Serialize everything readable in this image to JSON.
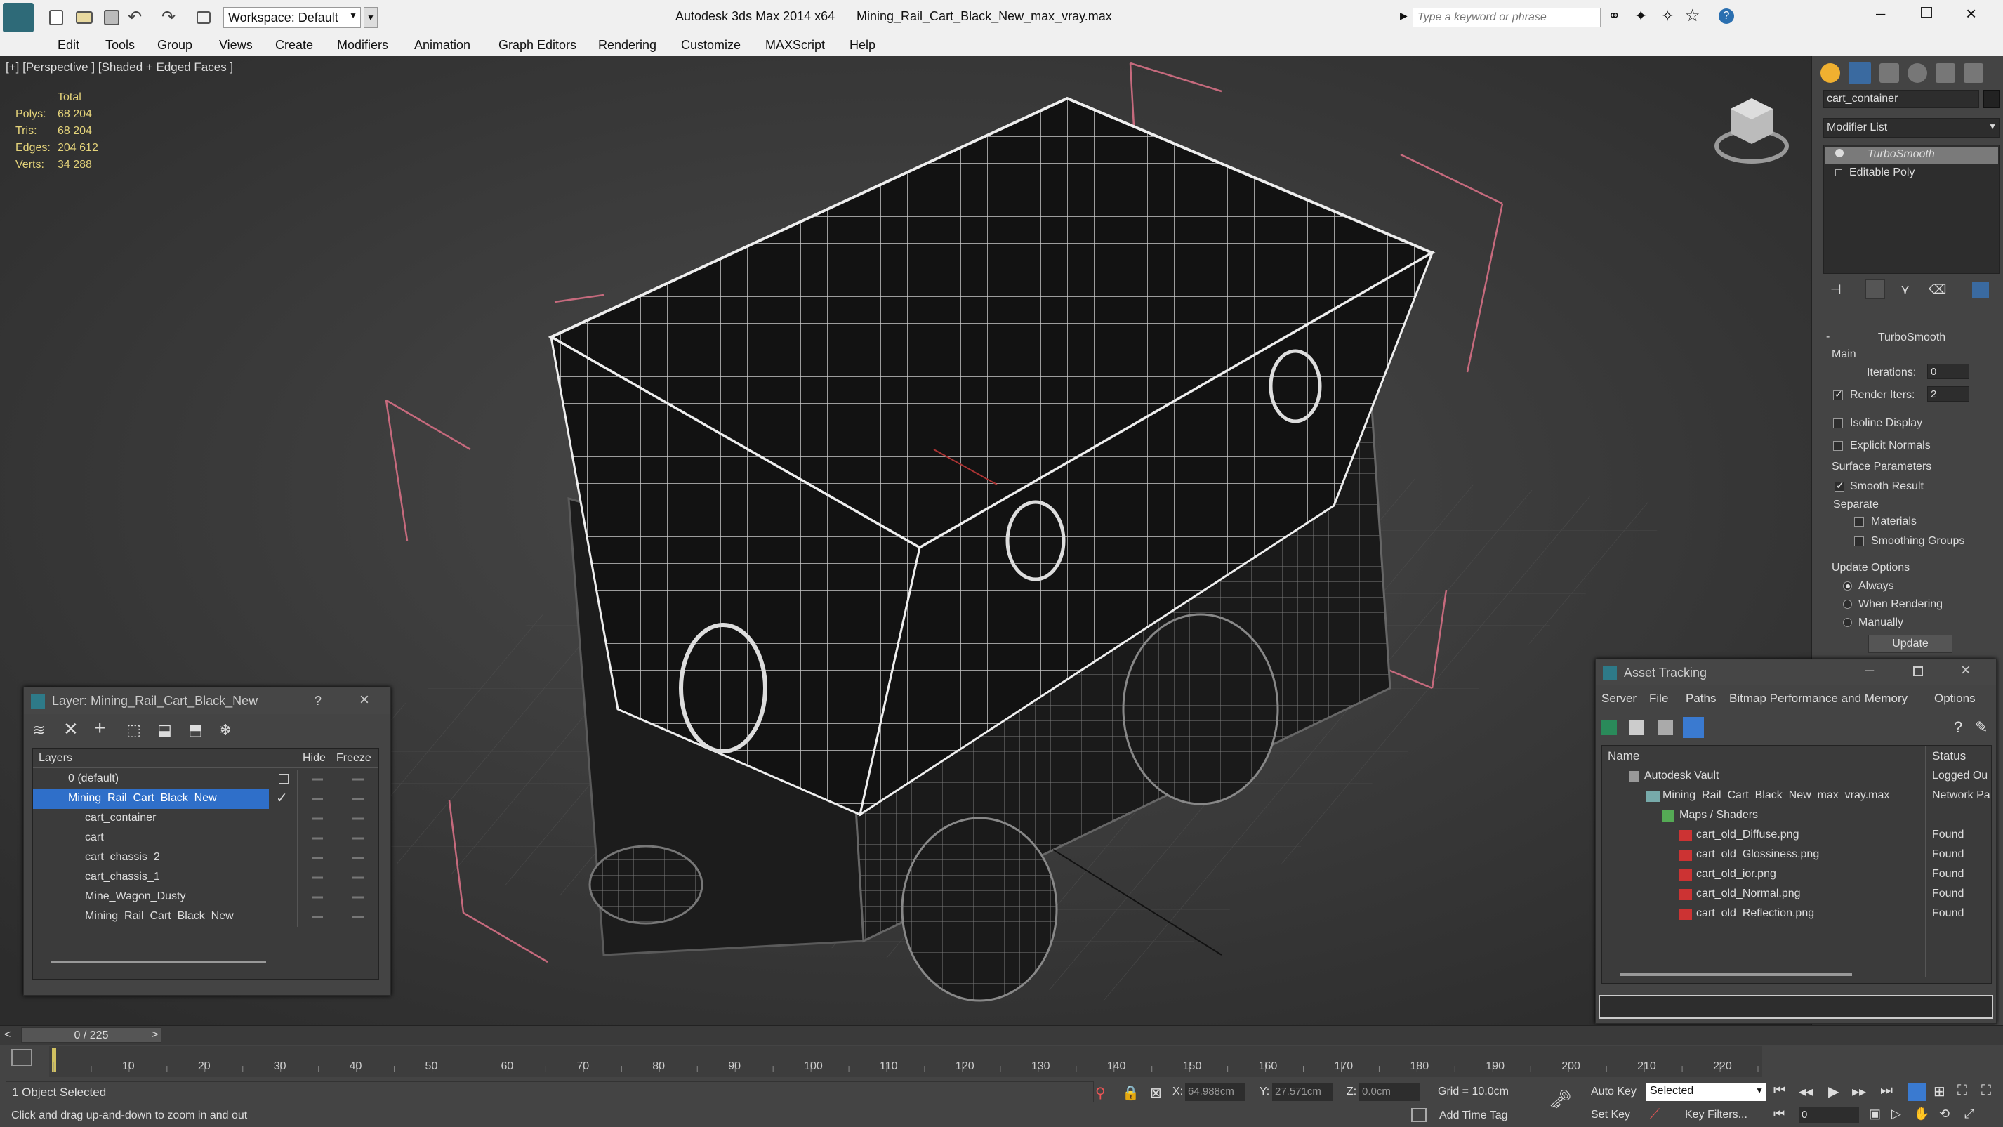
{
  "titlebar": {
    "app": "Autodesk 3ds Max  2014 x64",
    "file": "Mining_Rail_Cart_Black_New_max_vray.max",
    "workspace": "Workspace: Default",
    "search_placeholder": "Type a keyword or phrase"
  },
  "menu": [
    "Edit",
    "Tools",
    "Group",
    "Views",
    "Create",
    "Modifiers",
    "Animation",
    "Graph Editors",
    "Rendering",
    "Customize",
    "MAXScript",
    "Help"
  ],
  "viewport": {
    "label": "[+] [Perspective ] [Shaded + Edged Faces ]",
    "stats_header": "Total",
    "stats": [
      {
        "k": "Polys:",
        "v": "68 204"
      },
      {
        "k": "Tris:",
        "v": "68 204"
      },
      {
        "k": "Edges:",
        "v": "204 612"
      },
      {
        "k": "Verts:",
        "v": "34 288"
      }
    ]
  },
  "cmd": {
    "object_name": "cart_container",
    "modifier_list": "Modifier List",
    "stack": [
      "TurboSmooth",
      "Editable Poly"
    ],
    "rollout": "TurboSmooth",
    "main": "Main",
    "iterations_label": "Iterations:",
    "iterations": "0",
    "render_iters_label": "Render Iters:",
    "render_iters": "2",
    "isoline": "Isoline Display",
    "explicit": "Explicit Normals",
    "surface": "Surface Parameters",
    "smooth": "Smooth Result",
    "separate": "Separate",
    "materials": "Materials",
    "smoothing_groups": "Smoothing Groups",
    "update_options": "Update Options",
    "always": "Always",
    "when_rendering": "When Rendering",
    "manually": "Manually",
    "update_btn": "Update"
  },
  "layer": {
    "title": "Layer: Mining_Rail_Cart_Black_New",
    "help": "?",
    "col_layers": "Layers",
    "col_hide": "Hide",
    "col_freeze": "Freeze",
    "rows": [
      "0 (default)",
      "Mining_Rail_Cart_Black_New",
      "cart_container",
      "cart",
      "cart_chassis_2",
      "cart_chassis_1",
      "Mine_Wagon_Dusty",
      "Mining_Rail_Cart_Black_New"
    ]
  },
  "asset": {
    "title": "Asset Tracking",
    "menu": [
      "Server",
      "File",
      "Paths",
      "Bitmap Performance and Memory",
      "Options"
    ],
    "col_name": "Name",
    "col_status": "Status",
    "rows": [
      {
        "name": "Autodesk Vault",
        "status": "Logged Ou"
      },
      {
        "name": "Mining_Rail_Cart_Black_New_max_vray.max",
        "status": "Network Pa"
      },
      {
        "name": "Maps / Shaders",
        "status": ""
      },
      {
        "name": "cart_old_Diffuse.png",
        "status": "Found"
      },
      {
        "name": "cart_old_Glossiness.png",
        "status": "Found"
      },
      {
        "name": "cart_old_ior.png",
        "status": "Found"
      },
      {
        "name": "cart_old_Normal.png",
        "status": "Found"
      },
      {
        "name": "cart_old_Reflection.png",
        "status": "Found"
      }
    ]
  },
  "timeline": {
    "frame": "0 / 225",
    "ticks": [
      "10",
      "20",
      "30",
      "40",
      "50",
      "60",
      "70",
      "80",
      "90",
      "100",
      "110",
      "120",
      "130",
      "140",
      "150",
      "160",
      "170",
      "180",
      "190",
      "200",
      "210",
      "220"
    ]
  },
  "status": {
    "selected": "1 Object Selected",
    "hint": "Click and drag up-and-down to zoom in and out",
    "x_label": "X:",
    "x": "64.988cm",
    "y_label": "Y:",
    "y": "27.571cm",
    "z_label": "Z:",
    "z": "0.0cm",
    "grid": "Grid = 10.0cm",
    "auto_key": "Auto Key",
    "set_key": "Set Key",
    "selected_dd": "Selected",
    "key_filters": "Key Filters...",
    "add_time_tag": "Add Time Tag",
    "frame_field": "0"
  }
}
